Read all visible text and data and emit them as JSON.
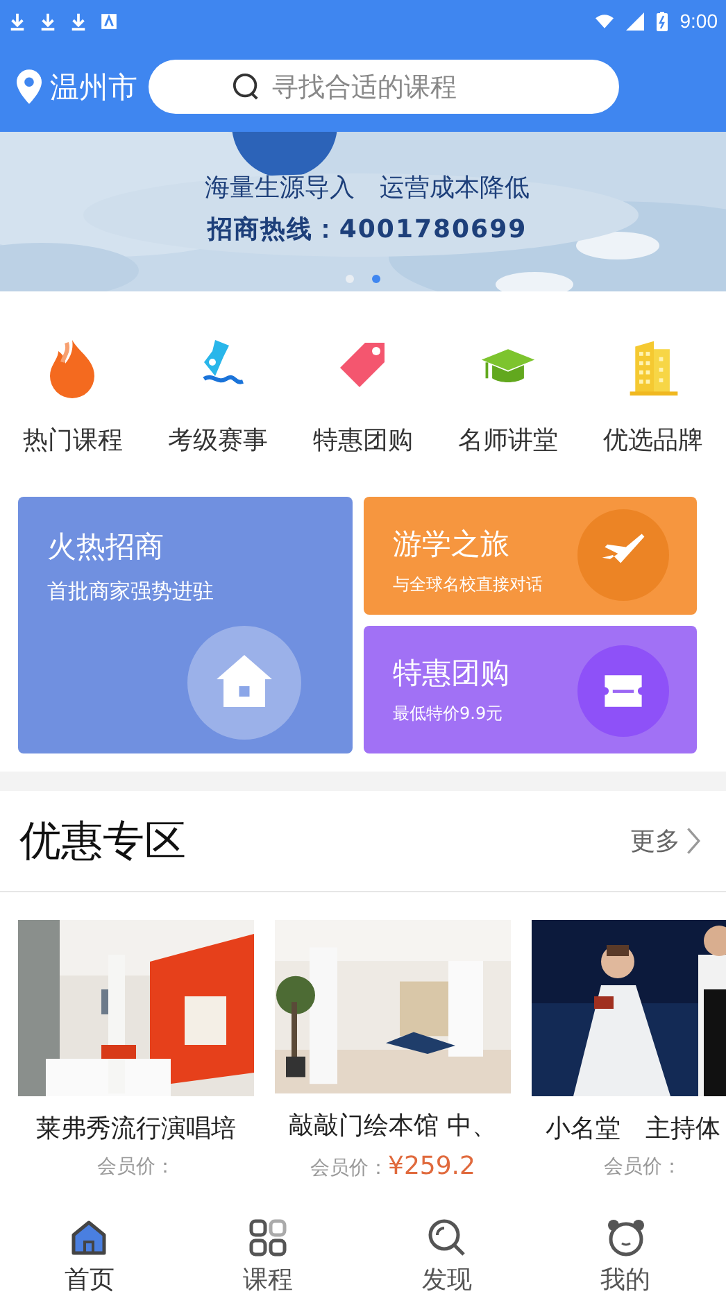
{
  "status_bar": {
    "time": "9:00"
  },
  "header": {
    "city": "温州市",
    "search": {
      "placeholder": "寻找合适的课程"
    }
  },
  "banner": {
    "lines": [
      "海量生源导入　运营成本降低",
      "招商热线：4001780699"
    ],
    "dots": [
      {
        "selected": false
      },
      {
        "selected": true
      }
    ]
  },
  "categories": [
    {
      "label": "热门课程"
    },
    {
      "label": "考级赛事"
    },
    {
      "label": "特惠团购"
    },
    {
      "label": "名师讲堂"
    },
    {
      "label": "优选品牌"
    }
  ],
  "promo_cards": [
    {
      "title": "火热招商",
      "subtitle": "首批商家强势进驻"
    },
    {
      "title": "游学之旅",
      "subtitle": "与全球名校直接对话"
    },
    {
      "title": "特惠团购",
      "subtitle": "最低特价9.9元"
    }
  ],
  "section": {
    "title": "优惠专区",
    "more": "更多"
  },
  "products": [
    {
      "title": "莱弗秀流行演唱培",
      "price_label": "会员价："
    },
    {
      "title": "敲敲门绘本馆 中、",
      "price_label": "会员价：",
      "price": "¥259.2"
    },
    {
      "title": "小名堂　主持体",
      "price_label": "会员价："
    }
  ],
  "tab_bar": [
    {
      "label": "首页",
      "selected": true
    },
    {
      "label": "课程",
      "selected": false
    },
    {
      "label": "发现",
      "selected": false
    },
    {
      "label": "我的",
      "selected": false
    }
  ]
}
